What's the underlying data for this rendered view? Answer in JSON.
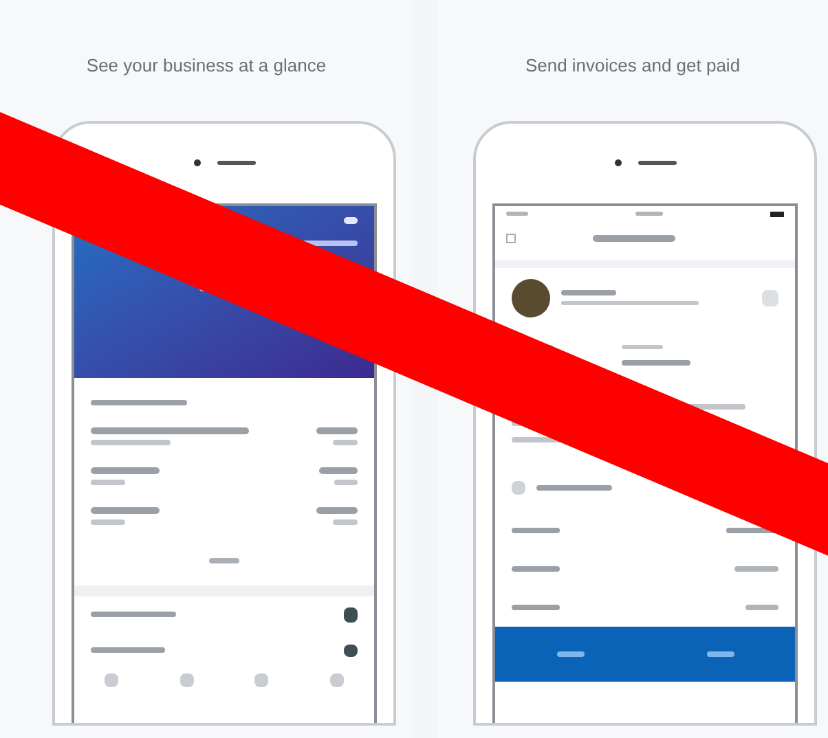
{
  "panels": [
    {
      "caption": "See your business at a glance",
      "kind": "dashboard"
    },
    {
      "caption": "Send invoices and get paid",
      "kind": "invoice"
    }
  ]
}
